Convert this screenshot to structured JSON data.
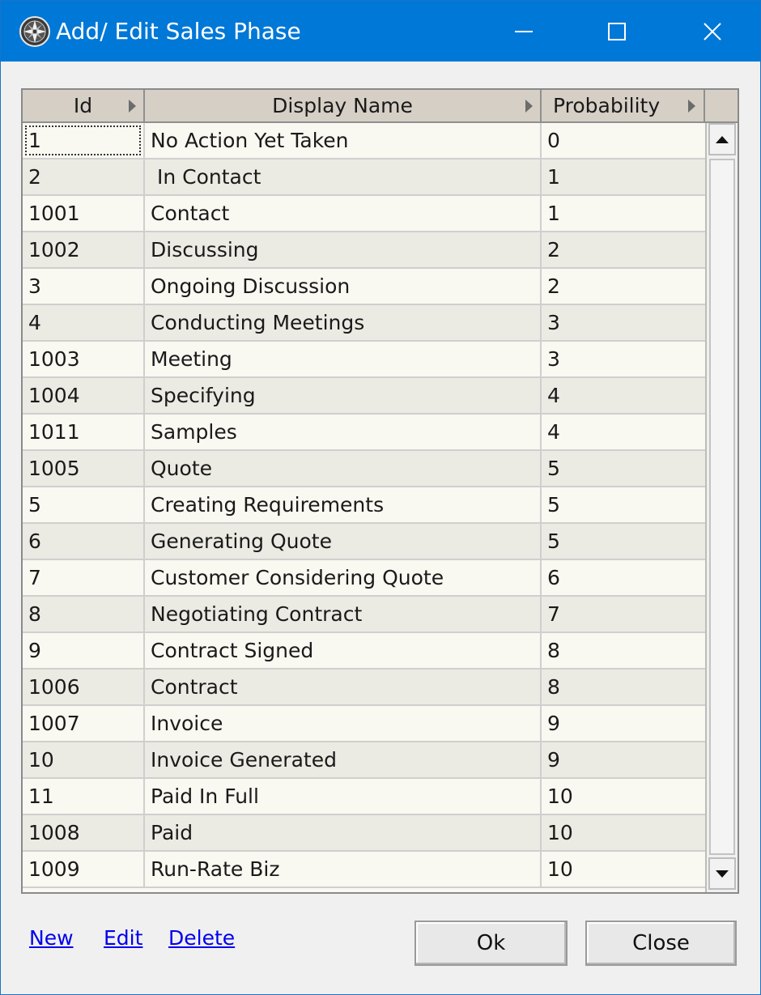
{
  "window": {
    "title": "Add/ Edit Sales Phase",
    "titlebar_color": "#0078d7",
    "icons": [
      "compass-app-icon",
      "minimize-icon",
      "maximize-icon",
      "close-icon"
    ]
  },
  "grid": {
    "columns": [
      {
        "label": "Id"
      },
      {
        "label": "Display Name"
      },
      {
        "label": "Probability"
      }
    ],
    "rows": [
      {
        "id": "1",
        "name": "No Action Yet Taken",
        "probability": "0"
      },
      {
        "id": "2",
        "name": " In Contact",
        "probability": "1"
      },
      {
        "id": "1001",
        "name": "Contact",
        "probability": "1"
      },
      {
        "id": "1002",
        "name": "Discussing",
        "probability": "2"
      },
      {
        "id": "3",
        "name": "Ongoing Discussion",
        "probability": "2"
      },
      {
        "id": "4",
        "name": "Conducting Meetings",
        "probability": "3"
      },
      {
        "id": "1003",
        "name": "Meeting",
        "probability": "3"
      },
      {
        "id": "1004",
        "name": "Specifying",
        "probability": "4"
      },
      {
        "id": "1011",
        "name": "Samples",
        "probability": "4"
      },
      {
        "id": "1005",
        "name": "Quote",
        "probability": "5"
      },
      {
        "id": "5",
        "name": "Creating Requirements",
        "probability": "5"
      },
      {
        "id": "6",
        "name": "Generating Quote",
        "probability": "5"
      },
      {
        "id": "7",
        "name": "Customer Considering Quote",
        "probability": "6"
      },
      {
        "id": "8",
        "name": "Negotiating Contract",
        "probability": "7"
      },
      {
        "id": "9",
        "name": "Contract Signed",
        "probability": "8"
      },
      {
        "id": "1006",
        "name": "Contract",
        "probability": "8"
      },
      {
        "id": "1007",
        "name": "Invoice",
        "probability": "9"
      },
      {
        "id": "10",
        "name": "Invoice Generated",
        "probability": "9"
      },
      {
        "id": "11",
        "name": "Paid In Full",
        "probability": "10"
      },
      {
        "id": "1008",
        "name": "Paid",
        "probability": "10"
      },
      {
        "id": "1009",
        "name": "Run-Rate Biz",
        "probability": "10"
      }
    ]
  },
  "links": {
    "new": "New",
    "edit": "Edit",
    "delete": "Delete"
  },
  "buttons": {
    "ok": "Ok",
    "close": "Close"
  }
}
